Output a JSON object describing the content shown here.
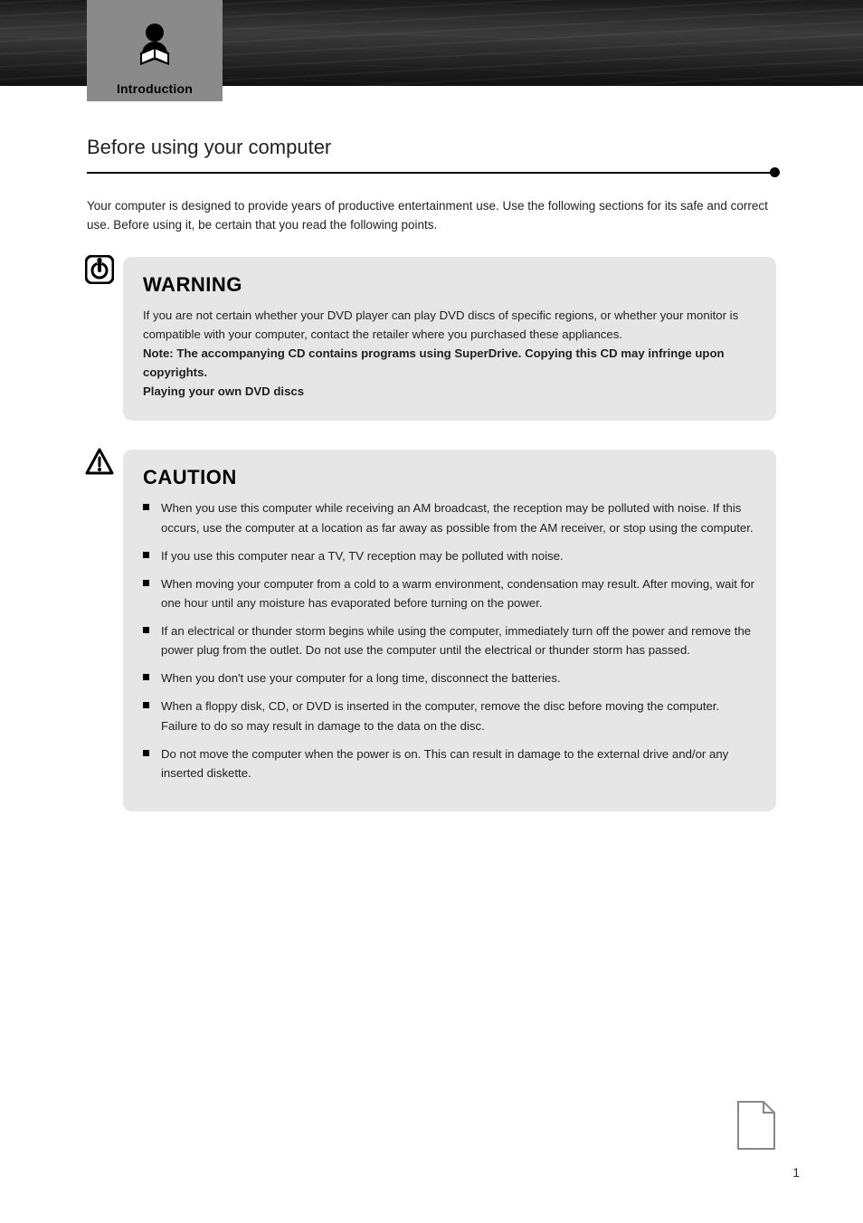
{
  "tab": {
    "label": "Introduction"
  },
  "section": {
    "title": "Before using your computer"
  },
  "intro": "Your computer is designed to provide years of productive entertainment use. Use the following sections for its safe and correct use. Before using it, be certain that you read the following points.",
  "warning": {
    "heading": "WARNING",
    "paragraphs": [
      "If you are not certain whether your DVD player can play DVD discs of specific regions, or whether your monitor is compatible with your computer, contact the retailer where you purchased these appliances.",
      "Note: The accompanying CD contains programs using SuperDrive. Copying this CD may infringe upon copyrights.",
      "Playing your own DVD discs"
    ]
  },
  "caution": {
    "heading": "CAUTION",
    "items": [
      "When you use this computer while receiving an AM broadcast, the reception may be polluted with noise. If this occurs, use the computer at a location as far away as possible from the AM receiver, or stop using the computer.",
      "If you use this computer near a TV, TV reception may be polluted with noise.",
      "When moving your computer from a cold to a warm environment, condensation may result. After moving, wait for one hour until any moisture has evaporated before turning on the power.",
      "If an electrical or thunder storm begins while using the computer, immediately turn off the power and remove the power plug from the outlet. Do not use the computer until the electrical or thunder storm has passed.",
      "When you don't use your computer for a long time, disconnect the batteries.",
      "When a floppy disk, CD, or DVD is inserted in the computer, remove the disc before moving the computer. Failure to do so may result in damage to the data on the disc.",
      "Do not move the computer when the power is on. This can result in damage to the external drive and/or any inserted diskette."
    ]
  },
  "pageNumber": "1"
}
